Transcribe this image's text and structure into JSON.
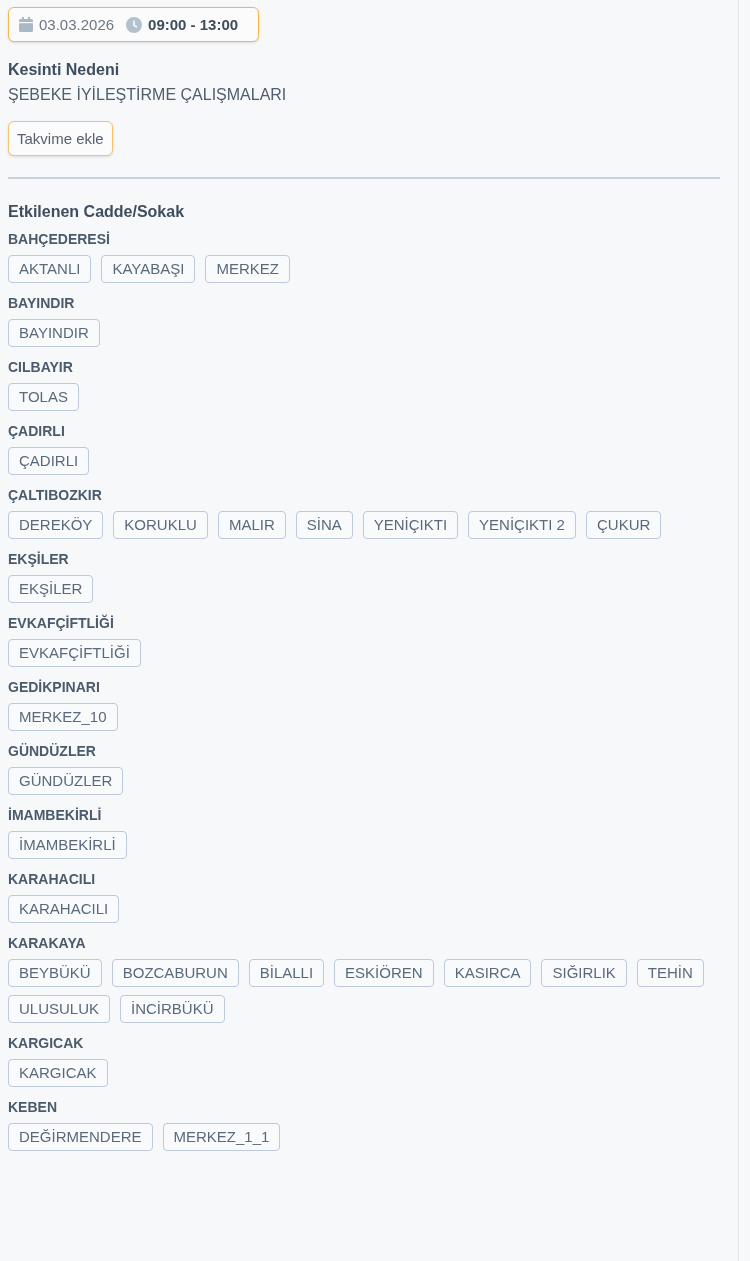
{
  "outage": {
    "date": "03.03.2026",
    "time": "09:00 - 13:00",
    "reason_label": "Kesinti Nedeni",
    "reason": "ŞEBEKE İYİLEŞTİRME ÇALIŞMALARI",
    "calendar_button": "Takvime ekle"
  },
  "affected": {
    "title": "Etkilenen Cadde/Sokak",
    "groups": [
      {
        "name": "BAHÇEDERESİ",
        "streets": [
          "AKTANLI",
          "KAYABAŞI",
          "MERKEZ"
        ]
      },
      {
        "name": "BAYINDIR",
        "streets": [
          "BAYINDIR"
        ]
      },
      {
        "name": "CILBAYIR",
        "streets": [
          "TOLAS"
        ]
      },
      {
        "name": "ÇADIRLI",
        "streets": [
          "ÇADIRLI"
        ]
      },
      {
        "name": "ÇALTIBOZKIR",
        "streets": [
          "DEREKÖY",
          "KORUKLU",
          "MALIR",
          "SİNA",
          "YENİÇIKTI",
          "YENİÇIKTI 2",
          "ÇUKUR"
        ]
      },
      {
        "name": "EKŞİLER",
        "streets": [
          "EKŞİLER"
        ]
      },
      {
        "name": "EVKAFÇİFTLİĞİ",
        "streets": [
          "EVKAFÇİFTLİĞİ"
        ]
      },
      {
        "name": "GEDİKPINARI",
        "streets": [
          "MERKEZ_10"
        ]
      },
      {
        "name": "GÜNDÜZLER",
        "streets": [
          "GÜNDÜZLER"
        ]
      },
      {
        "name": "İMAMBEKİRLİ",
        "streets": [
          "İMAMBEKİRLİ"
        ]
      },
      {
        "name": "KARAHACILI",
        "streets": [
          "KARAHACILI"
        ]
      },
      {
        "name": "KARAKAYA",
        "streets": [
          "BEYBÜKÜ",
          "BOZCABURUN",
          "BİLALLI",
          "ESKİÖREN",
          "KASIRCA",
          "SIĞIRLIK",
          "TEHİN",
          "ULUSULUK",
          "İNCİRBÜKÜ"
        ]
      },
      {
        "name": "KARGICAK",
        "streets": [
          "KARGICAK"
        ]
      },
      {
        "name": "KEBEN",
        "streets": [
          "DEĞİRMENDERE",
          "MERKEZ_1_1"
        ]
      }
    ]
  }
}
